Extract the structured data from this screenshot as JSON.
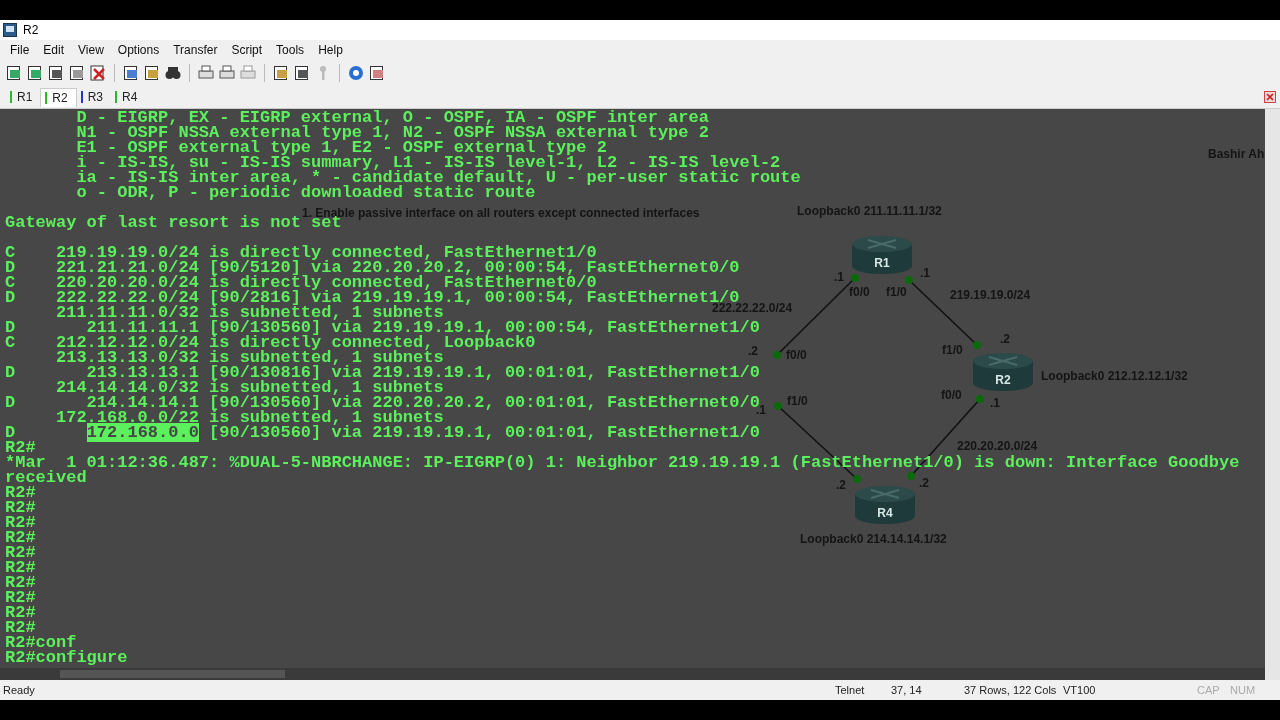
{
  "window": {
    "title": "R2"
  },
  "menu": [
    "File",
    "Edit",
    "View",
    "Options",
    "Transfer",
    "Script",
    "Tools",
    "Help"
  ],
  "tabs": [
    {
      "label": "R1",
      "selected": false,
      "color": "#2fb82f"
    },
    {
      "label": "R2",
      "selected": true,
      "color": "#2fb82f"
    },
    {
      "label": "R3",
      "selected": false,
      "color": "#2a33d0"
    },
    {
      "label": "R4",
      "selected": false,
      "color": "#2fb82f"
    }
  ],
  "terminal": {
    "lines": [
      {
        "text": "       D - EIGRP, EX - EIGRP external, O - OSPF, IA - OSPF inter area"
      },
      {
        "text": "       N1 - OSPF NSSA external type 1, N2 - OSPF NSSA external type 2"
      },
      {
        "text": "       E1 - OSPF external type 1, E2 - OSPF external type 2"
      },
      {
        "text": "       i - IS-IS, su - IS-IS summary, L1 - IS-IS level-1, L2 - IS-IS level-2"
      },
      {
        "text": "       ia - IS-IS inter area, * - candidate default, U - per-user static route"
      },
      {
        "text": "       o - ODR, P - periodic downloaded static route"
      },
      {
        "text": "Gateway of last resort is not set",
        "blank_before": true
      },
      {
        "text": "C    219.19.19.0/24 is directly connected, FastEthernet1/0",
        "blank_before": true
      },
      {
        "text": "D    221.21.21.0/24 [90/5120] via 220.20.20.2, 00:00:54, FastEthernet0/0"
      },
      {
        "text": "C    220.20.20.0/24 is directly connected, FastEthernet0/0"
      },
      {
        "text": "D    222.22.22.0/24 [90/2816] via 219.19.19.1, 00:00:54, FastEthernet1/0"
      },
      {
        "text": "     211.11.11.0/32 is subnetted, 1 subnets"
      },
      {
        "text": "D       211.11.11.1 [90/130560] via 219.19.19.1, 00:00:54, FastEthernet1/0"
      },
      {
        "text": "C    212.12.12.0/24 is directly connected, Loopback0"
      },
      {
        "text": "     213.13.13.0/32 is subnetted, 1 subnets"
      },
      {
        "text": "D       213.13.13.1 [90/130816] via 219.19.19.1, 00:01:01, FastEthernet1/0"
      },
      {
        "text": "     214.14.14.0/32 is subnetted, 1 subnets"
      },
      {
        "text": "D       214.14.14.1 [90/130560] via 220.20.20.2, 00:01:01, FastEthernet0/0"
      },
      {
        "text": "     172.168.0.0/22 is subnetted, 1 subnets"
      },
      {
        "segments": [
          {
            "text": "D       ",
            "selected": false
          },
          {
            "text": "172.168.0.0",
            "selected": true
          },
          {
            "text": " [90/130560] via 219.19.19.1, 00:01:01, FastEthernet1/0",
            "selected": false
          }
        ]
      },
      {
        "text": "R2#"
      },
      {
        "text": "*Mar  1 01:12:36.487: %DUAL-5-NBRCHANGE: IP-EIGRP(0) 1: Neighbor 219.19.19.1 (FastEthernet1/0) is down: Interface Goodbye"
      },
      {
        "text": "received"
      },
      {
        "text": "R2#"
      },
      {
        "text": "R2#"
      },
      {
        "text": "R2#"
      },
      {
        "text": "R2#"
      },
      {
        "text": "R2#"
      },
      {
        "text": "R2#"
      },
      {
        "text": "R2#"
      },
      {
        "text": "R2#"
      },
      {
        "text": "R2#"
      },
      {
        "text": "R2#"
      },
      {
        "text": "R2#conf"
      },
      {
        "text": "R2#configure"
      }
    ]
  },
  "diagram": {
    "routers": [
      "R1",
      "R2",
      "R4"
    ],
    "labels": [
      "Bashir Ah",
      "1. Enable passive interface on all routers except connected interfaces",
      "Loopback0 211.11.11.1/32",
      ".1",
      ".1",
      "f0/0",
      "f1/0",
      "219.19.19.0/24",
      "222.22.22.0/24",
      ".2",
      "f0/0",
      ".2",
      "f1/0",
      "Loopback0 212.12.12.1/32",
      "f0/0",
      ".1",
      "f1/0",
      ".1",
      "220.20.20.0/24",
      ".2",
      ".2",
      "Loopback0 214.14.14.1/32"
    ]
  },
  "status_bar": [
    {
      "text": "Ready",
      "disabled": false
    },
    {
      "text": "Telnet",
      "disabled": false
    },
    {
      "text": "37,  14",
      "disabled": false
    },
    {
      "text": "37 Rows, 122 Cols",
      "disabled": false
    },
    {
      "text": "VT100",
      "disabled": false
    },
    {
      "text": "CAP",
      "disabled": true
    },
    {
      "text": "NUM",
      "disabled": true
    }
  ]
}
